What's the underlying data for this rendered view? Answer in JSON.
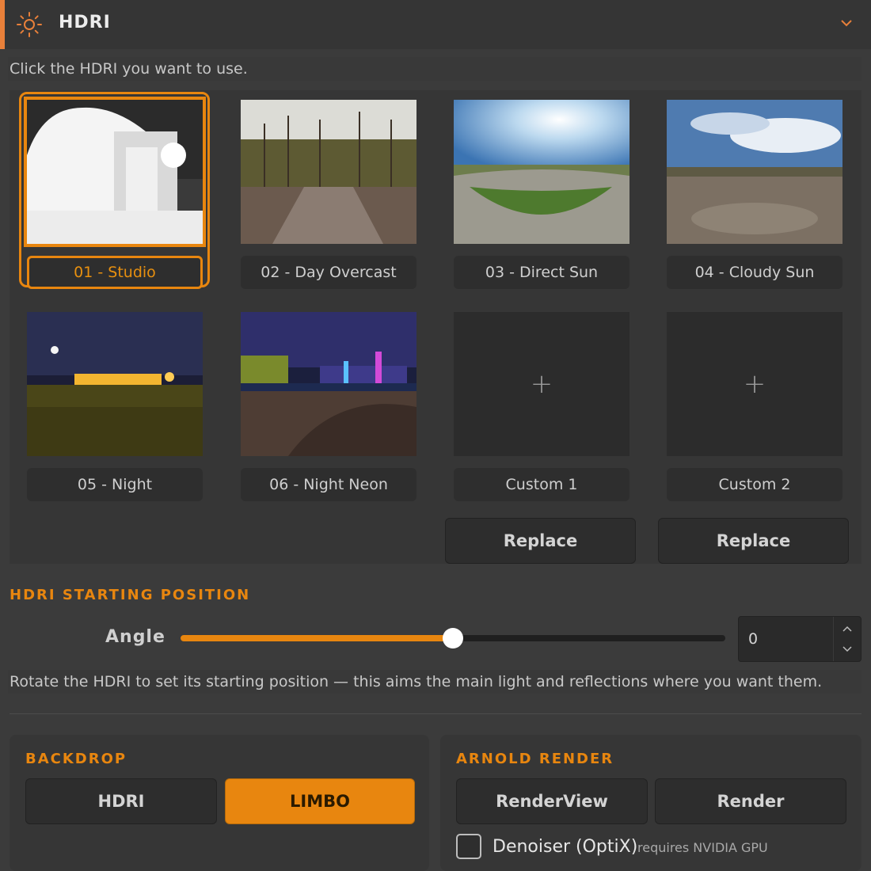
{
  "header": {
    "title": "HDRI",
    "icon": "sun-icon",
    "accent": "#e8803a"
  },
  "hint_top": "Click the HDRI you want to use.",
  "hdris": [
    {
      "label": "01 - Studio",
      "selected": true
    },
    {
      "label": "02 - Day Overcast"
    },
    {
      "label": "03 - Direct Sun"
    },
    {
      "label": "04 - Cloudy Sun"
    },
    {
      "label": "05 - Night"
    },
    {
      "label": "06 - Night Neon"
    },
    {
      "label": "Custom 1",
      "empty": true
    },
    {
      "label": "Custom 2",
      "empty": true
    }
  ],
  "plus_glyph": "+",
  "replace_label": "Replace",
  "starting_position": {
    "title": "HDRI STARTING POSITION",
    "angle_label": "Angle",
    "angle_value": "0",
    "slider_fraction": 0.5,
    "hint": "Rotate the HDRI to set its starting position — this aims the main light and reflections where you want them."
  },
  "backdrop": {
    "title": "BACKDROP",
    "options": [
      "HDRI",
      "LIMBO"
    ],
    "selected": "LIMBO"
  },
  "arnold": {
    "title": "ARNOLD RENDER",
    "renderview_label": "RenderView",
    "render_label": "Render",
    "denoiser_label": "Denoiser (OptiX)",
    "denoiser_note": "requires NVIDIA GPU",
    "denoiser_checked": false
  },
  "colors": {
    "accent": "#e8860f",
    "panel": "#363636",
    "background": "#3b3b3b"
  }
}
